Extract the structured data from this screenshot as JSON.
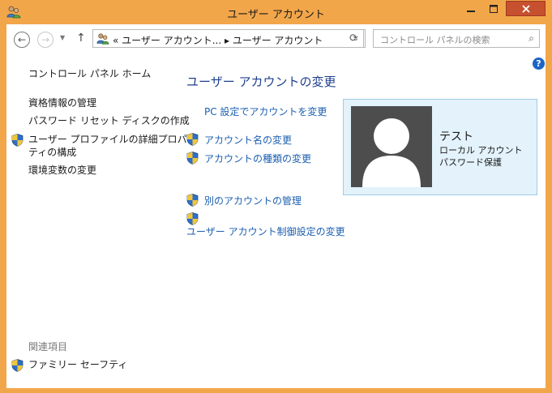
{
  "window": {
    "title": "ユーザー アカウント",
    "minimize_icon": "minimize-icon",
    "maximize_icon": "maximize-icon",
    "close_icon": "close-icon",
    "close_color": "#c7502e",
    "frame_color": "#f2a64a"
  },
  "address_bar": {
    "path": "« ユーザー アカウント... ▸ ユーザー アカウント",
    "search_placeholder": "コントロール パネルの検索"
  },
  "sidebar": {
    "home": "コントロール パネル ホーム",
    "items": [
      {
        "label": "資格情報の管理",
        "shield": false
      },
      {
        "label": "パスワード リセット ディスクの作成",
        "shield": false
      },
      {
        "label": "ユーザー プロファイルの詳細プロパティの構成",
        "line1": "ユーザー プロファイルの詳細プロパ",
        "line2": "ティの構成",
        "shield": true
      },
      {
        "label": "環境変数の変更",
        "shield": false
      }
    ],
    "related_heading": "関連項目",
    "related_items": [
      {
        "label": "ファミリー セーフティ",
        "shield": true
      }
    ]
  },
  "main": {
    "heading": "ユーザー アカウントの変更",
    "links": {
      "pc_settings": "PC 設定でアカウントを変更",
      "change_name": "アカウント名の変更",
      "change_type": "アカウントの種類の変更",
      "manage_other": "別のアカウントの管理",
      "uac_settings": "ユーザー アカウント制御設定の変更"
    }
  },
  "account": {
    "name": "テスト",
    "type": "ローカル アカウント",
    "password": "パスワード保護",
    "card_color": "#e3f2fb"
  },
  "accent_link_color": "#1c5fb0",
  "heading_color": "#1d3f8c"
}
